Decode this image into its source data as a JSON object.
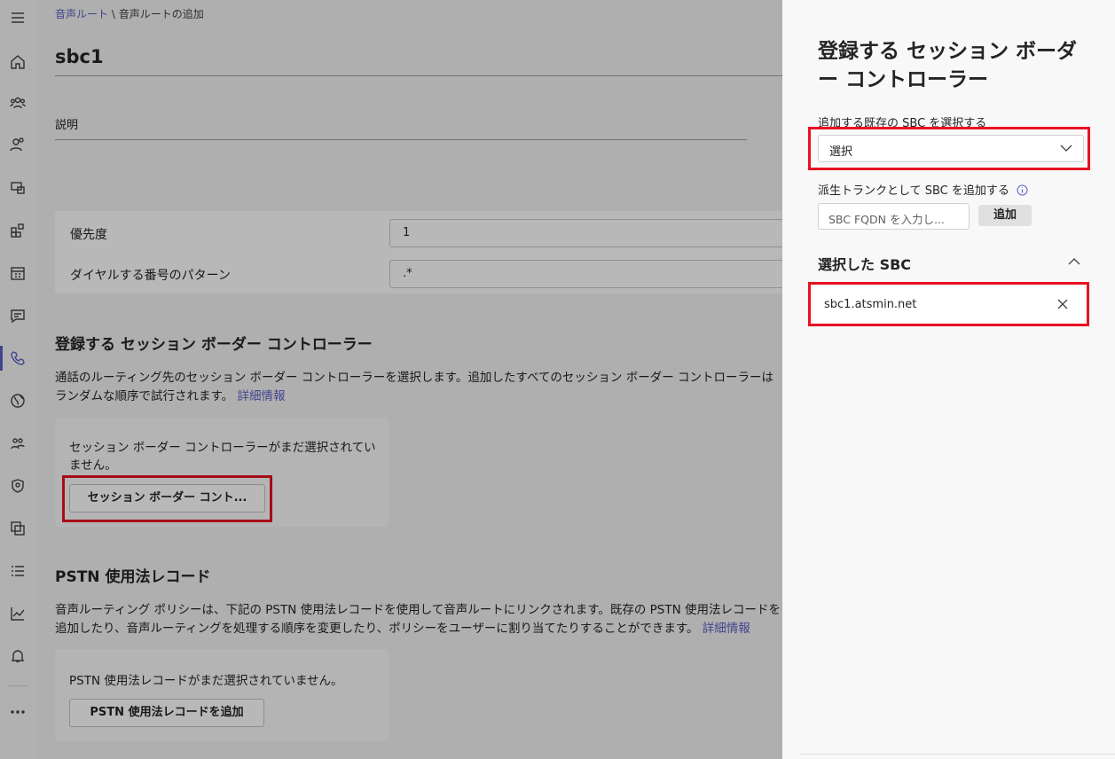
{
  "breadcrumb": {
    "parent": "音声ルート",
    "separator": "\\",
    "current": "音声ルートの追加"
  },
  "page": {
    "title": "sbc1",
    "description_label": "説明"
  },
  "properties": {
    "priority_label": "優先度",
    "priority_value": "1",
    "pattern_label": "ダイヤルする番号のパターン",
    "pattern_value": ".*"
  },
  "sbc_section": {
    "title": "登録する セッション ボーダー コントローラー",
    "description": "通話のルーティング先のセッション ボーダー コントローラーを選択します。追加したすべてのセッション ボーダー コントローラーはランダムな順序で試行されます。",
    "link": "詳細情報",
    "empty_text": "セッション ボーダー コントローラーがまだ選択されていません。",
    "button_label": "セッション ボーダー コント..."
  },
  "pstn_section": {
    "title": "PSTN 使用法レコード",
    "description": "音声ルーティング ポリシーは、下記の PSTN 使用法レコードを使用して音声ルートにリンクされます。既存の PSTN 使用法レコードを追加したり、音声ルーティングを処理する順序を変更したり、ポリシーをユーザーに割り当てたりすることができます。",
    "link": "詳細情報",
    "empty_text": "PSTN 使用法レコードがまだ選択されていません。",
    "button_label": "PSTN 使用法レコードを追加"
  },
  "panel": {
    "title": "登録する セッション ボーダー コントローラー",
    "select_label": "追加する既存の SBC を選択する",
    "select_value": "選択",
    "derived_label": "派生トランクとして SBC を追加する",
    "fqdn_placeholder": "SBC FQDN を入力し...",
    "add_button": "追加",
    "selected_title": "選択した SBC",
    "selected_items": [
      "sbc1.atsmin.net"
    ]
  },
  "rail": {
    "icons": [
      "menu-icon",
      "home-icon",
      "teams-icon",
      "users-icon",
      "devices-icon",
      "apps-icon",
      "meetings-icon",
      "messaging-icon",
      "voice-icon",
      "locations-icon",
      "enhanced-encryption-icon",
      "security-icon",
      "planning-icon",
      "reports-list-icon",
      "analytics-icon",
      "notifications-icon",
      "more-icon"
    ]
  },
  "colors": {
    "accent": "#5b5fc7",
    "highlight": "#e81123"
  }
}
